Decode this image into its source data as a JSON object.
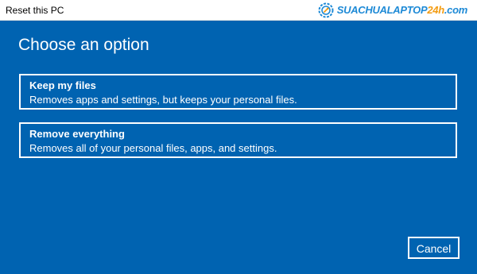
{
  "window": {
    "title": "Reset this PC"
  },
  "watermark": {
    "text_main": "SUACHUALAPTOP",
    "text_accent": "24h",
    "text_suffix": ".com",
    "icon": "gear-icon"
  },
  "main": {
    "heading": "Choose an option",
    "options": [
      {
        "title": "Keep my files",
        "description": "Removes apps and settings, but keeps your personal files."
      },
      {
        "title": "Remove everything",
        "description": "Removes all of your personal files, apps, and settings."
      }
    ],
    "cancel_label": "Cancel"
  },
  "colors": {
    "background": "#0063b1",
    "titlebar": "#ffffff",
    "text": "#ffffff",
    "watermark_main": "#1e8ad6",
    "watermark_accent": "#f39c12"
  }
}
